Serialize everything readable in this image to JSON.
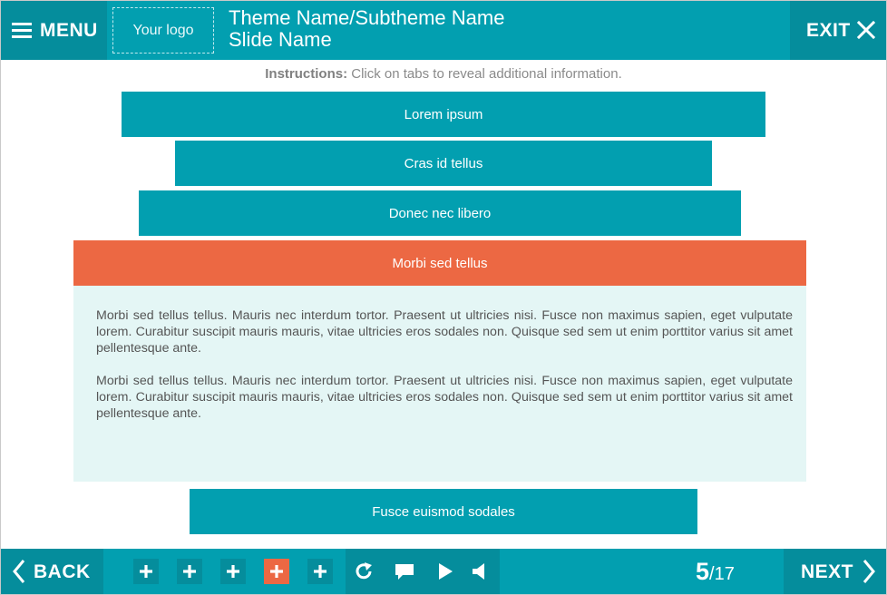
{
  "header": {
    "menu_label": "MENU",
    "logo_text": "Your logo",
    "theme_title": "Theme Name/Subtheme Name",
    "slide_name": "Slide Name",
    "exit_label": "EXIT"
  },
  "instructions": {
    "label": "Instructions:",
    "text": " Click on tabs to reveal additional information."
  },
  "tabs": [
    {
      "label": "Lorem ipsum"
    },
    {
      "label": "Cras id tellus"
    },
    {
      "label": "Donec nec libero"
    },
    {
      "label": "Morbi sed tellus",
      "active": true
    },
    {
      "label": "Fusce euismod sodales"
    }
  ],
  "panel": {
    "paragraphs": [
      "Morbi sed tellus tellus. Mauris nec interdum tortor. Praesent ut ultricies nisi. Fusce non maximus sapien, eget vulputate lorem. Curabitur suscipit mauris mauris, vitae ultricies eros sodales non. Quisque sed sem ut enim porttitor varius sit amet pellentesque ante.",
      "Morbi sed tellus tellus. Mauris nec interdum tortor. Praesent ut ultricies nisi. Fusce non maximus sapien, eget vulputate lorem. Curabitur suscipit mauris mauris, vitae ultricies eros sodales non. Quisque sed sem ut enim porttitor varius sit amet pellentesque ante."
    ]
  },
  "footer": {
    "back_label": "BACK",
    "next_label": "NEXT",
    "page_current": "5",
    "page_total": "/17",
    "tab_markers": [
      {
        "icon": "plus-icon",
        "active": false
      },
      {
        "icon": "plus-icon",
        "active": false
      },
      {
        "icon": "plus-icon",
        "active": false
      },
      {
        "icon": "plus-icon",
        "active": true
      },
      {
        "icon": "plus-icon",
        "active": false
      }
    ],
    "controls": [
      "replay-icon",
      "comment-icon",
      "play-icon",
      "volume-icon"
    ]
  },
  "colors": {
    "teal": "#029fb0",
    "teal_dark": "#058d9c",
    "accent": "#ec6843",
    "panel_bg": "#e4f6f5"
  }
}
